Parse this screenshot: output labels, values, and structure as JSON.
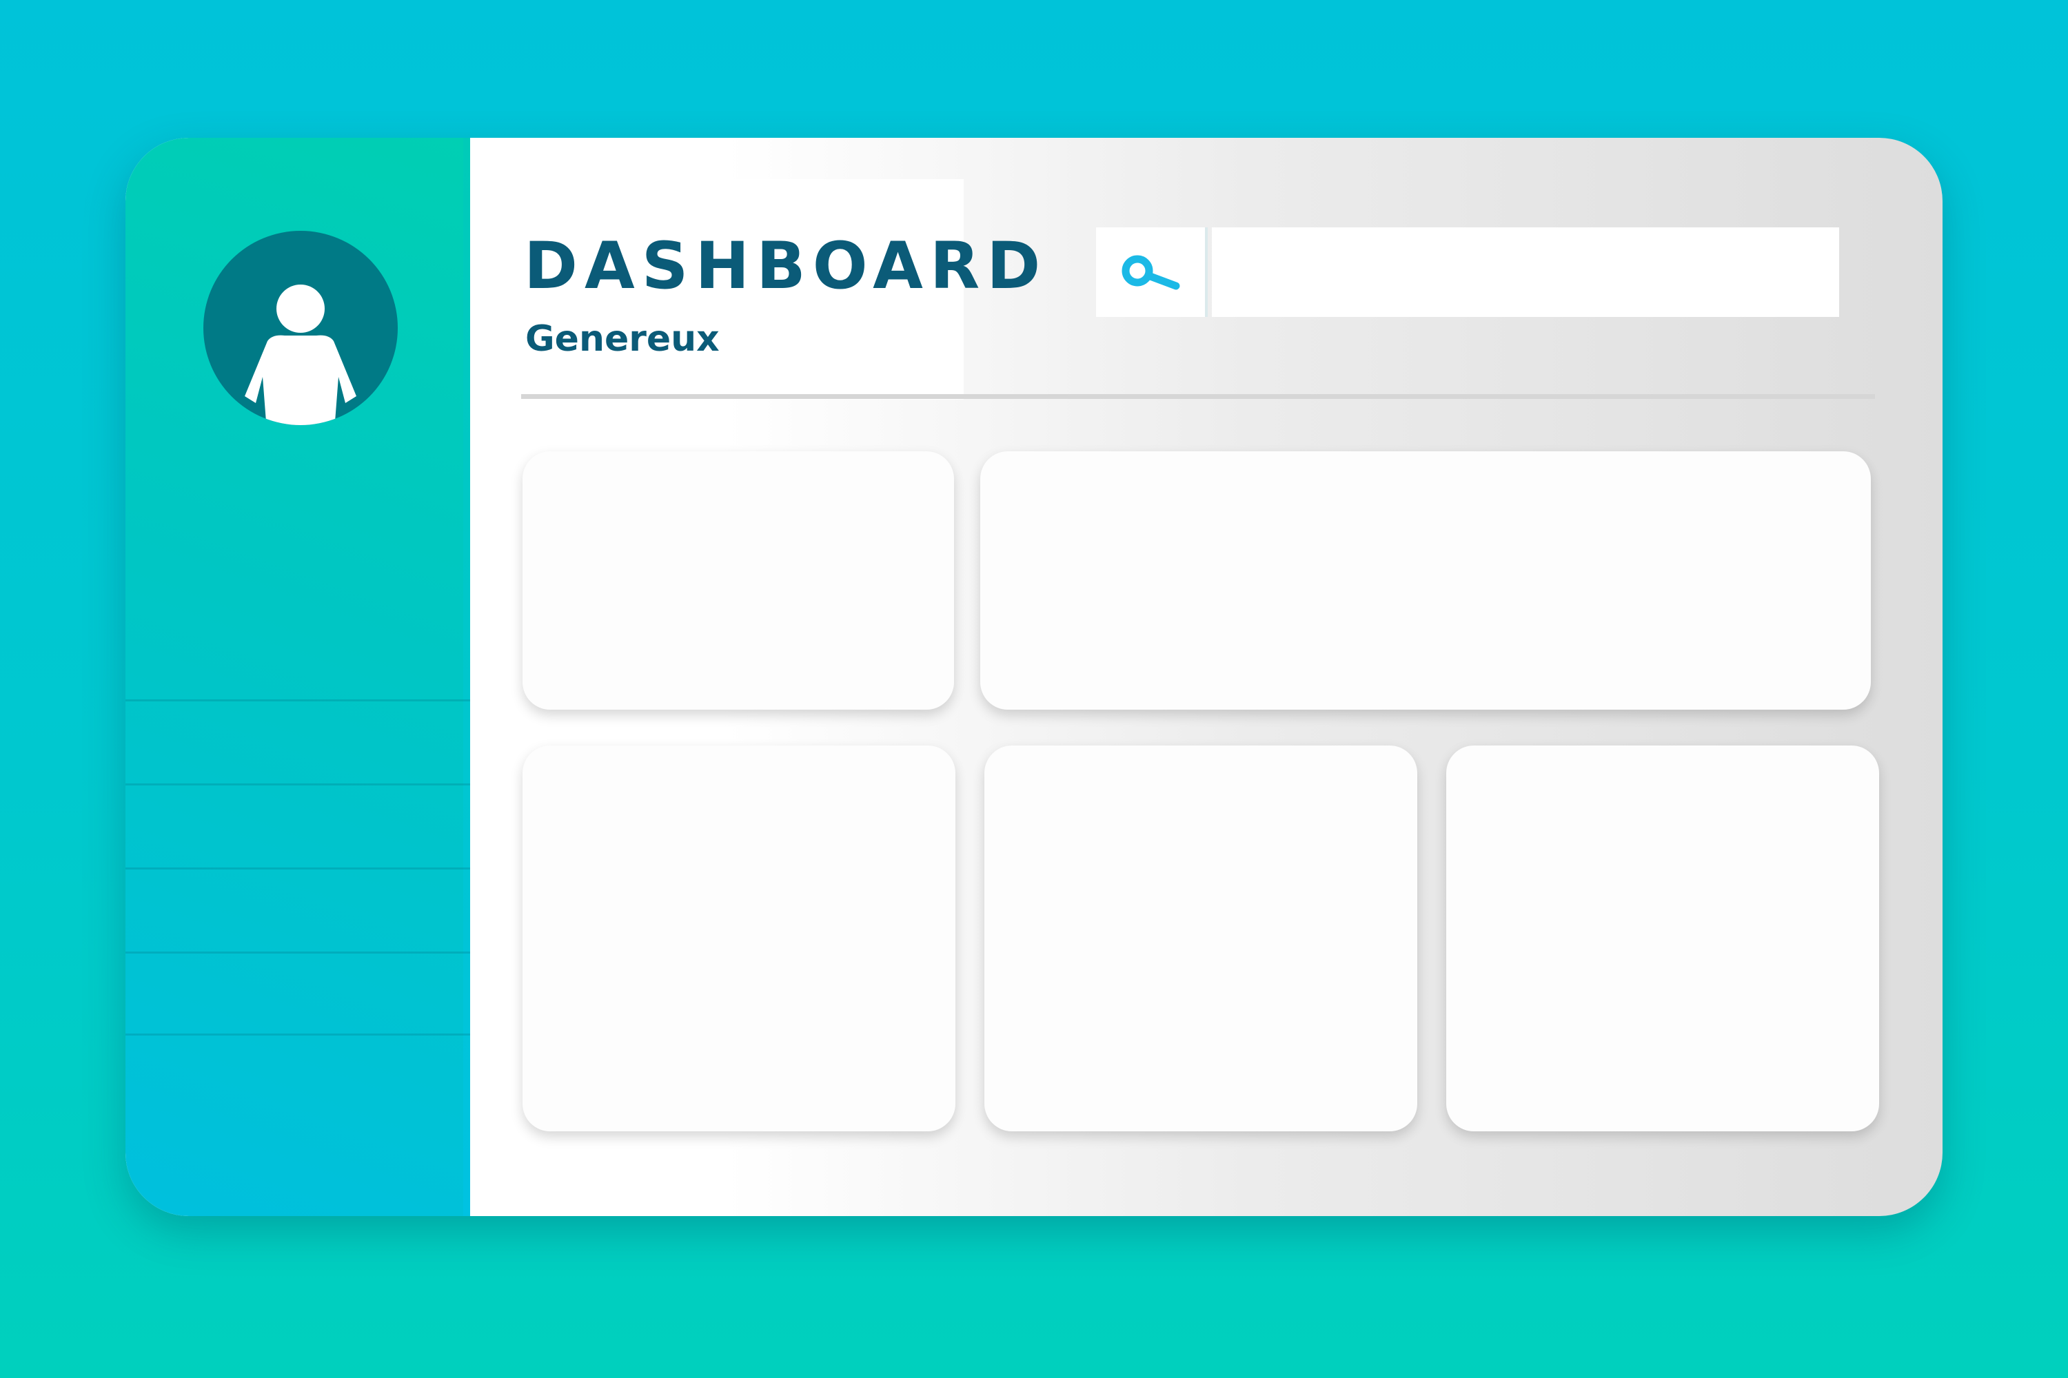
{
  "header": {
    "title": "DASHBOARD",
    "subtitle": "Genereux"
  },
  "search": {
    "icon": "search-icon",
    "value": "",
    "placeholder": ""
  },
  "sidebar": {
    "avatar_icon": "user-icon",
    "items": [
      {
        "label": ""
      },
      {
        "label": ""
      },
      {
        "label": ""
      },
      {
        "label": ""
      }
    ]
  },
  "colors": {
    "background": "#00c6d2",
    "sidebar": "#00c6c4",
    "accent": "#0b5b78",
    "avatar_bg": "#007a86",
    "search_icon": "#1bb9e6"
  },
  "cards": [
    {
      "id": "card-1"
    },
    {
      "id": "card-2"
    },
    {
      "id": "card-3"
    },
    {
      "id": "card-4"
    },
    {
      "id": "card-5"
    }
  ]
}
